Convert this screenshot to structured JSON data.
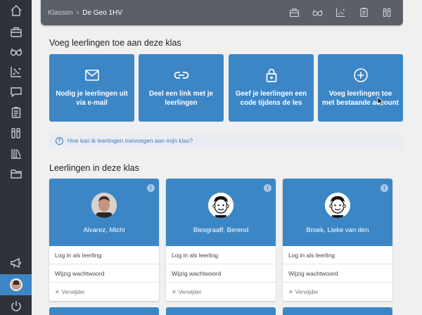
{
  "breadcrumb": {
    "parent": "Klassen",
    "current": "De Geo 1HV"
  },
  "top_icons": [
    "briefcase-icon",
    "glasses-icon",
    "chart-icon",
    "clipboard-icon",
    "books-icon"
  ],
  "sidebar": {
    "items": [
      "home-icon",
      "briefcase-icon",
      "glasses-icon",
      "chart-icon",
      "chat-icon",
      "clipboard-icon",
      "books-icon",
      "library-icon",
      "folder-icon"
    ],
    "bottom": [
      "megaphone-icon",
      "avatar",
      "power-icon"
    ]
  },
  "add_section": {
    "title": "Voeg leerlingen toe aan deze klas",
    "tiles": [
      {
        "icon": "mail-icon",
        "label": "Nodig je leerlingen uit via e-mail"
      },
      {
        "icon": "link-icon",
        "label": "Deel een link met je leerlingen"
      },
      {
        "icon": "lock-icon",
        "label": "Geef je leerlingen een code tijdens de les"
      },
      {
        "icon": "plus-circle-icon",
        "label": "Voeg leerlingen toe met bestaande account"
      }
    ]
  },
  "help": {
    "text": "Hoe kan ik leerlingen toevoegen aan mijn klas?"
  },
  "students_section": {
    "title": "Leerlingen in deze klas",
    "students": [
      {
        "name": "Alvarez, Michi",
        "avatar": "photo"
      },
      {
        "name": "Blesgraaff, Berend",
        "avatar": "cartoon"
      },
      {
        "name": "Broek, Lieke van den",
        "avatar": "cartoon"
      }
    ],
    "actions": {
      "login": "Log in als leerling",
      "password": "Wijzig wachtwoord",
      "remove": "Verwijder"
    }
  },
  "colors": {
    "accent": "#3d86c6",
    "sidebar": "#2f3339",
    "topbar": "#5b5f66"
  }
}
